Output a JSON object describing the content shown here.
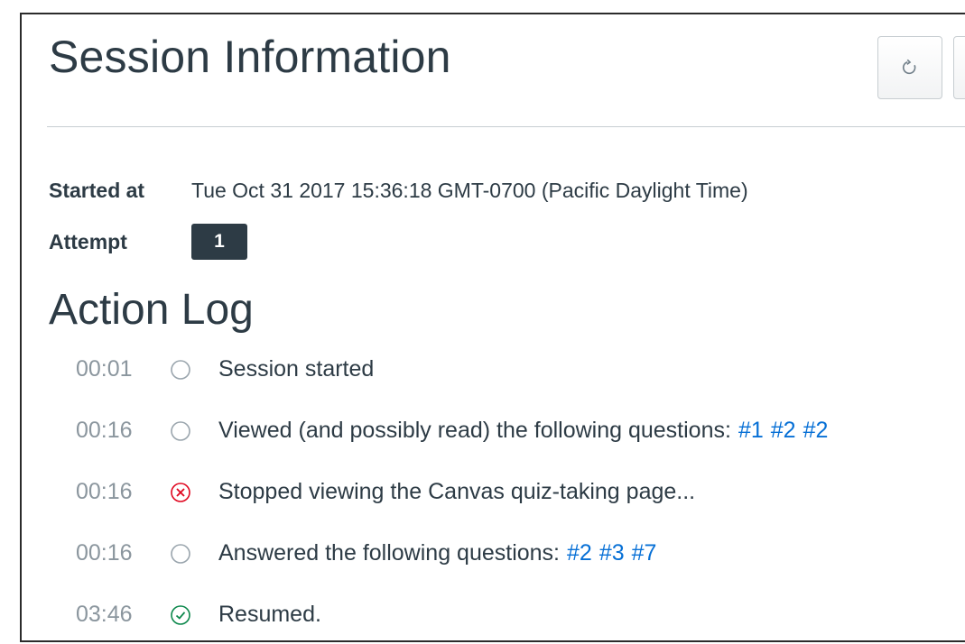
{
  "header": {
    "title": "Session Information",
    "reload_icon": "reload-icon"
  },
  "session": {
    "started_label": "Started at",
    "started_value": "Tue Oct 31 2017 15:36:18 GMT-0700 (Pacific Daylight Time)",
    "attempt_label": "Attempt",
    "attempt_value": "1"
  },
  "action_log": {
    "title": "Action Log",
    "events": [
      {
        "time": "00:01",
        "icon": "empty-circle-icon",
        "text": "Session started",
        "links": []
      },
      {
        "time": "00:16",
        "icon": "empty-circle-icon",
        "text": "Viewed (and possibly read) the following questions:",
        "links": [
          "#1",
          "#2",
          "#2"
        ]
      },
      {
        "time": "00:16",
        "icon": "x-circle-icon",
        "text": "Stopped viewing the Canvas quiz-taking page...",
        "links": []
      },
      {
        "time": "00:16",
        "icon": "empty-circle-icon",
        "text": "Answered the following questions:",
        "links": [
          "#2",
          "#3",
          "#7"
        ]
      },
      {
        "time": "03:46",
        "icon": "check-circle-icon",
        "text": "Resumed.",
        "links": []
      }
    ]
  },
  "colors": {
    "text": "#2d3b45",
    "muted": "#8b969e",
    "link": "#0770d6",
    "error": "#e0061f",
    "success": "#0b874b",
    "badge": "#2d3b45"
  }
}
